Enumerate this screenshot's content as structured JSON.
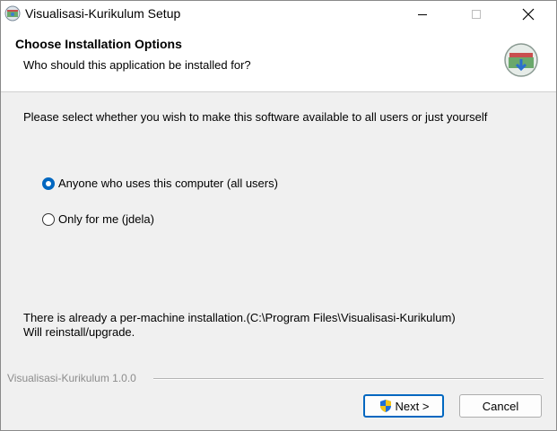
{
  "window": {
    "title": "Visualisasi-Kurikulum Setup"
  },
  "header": {
    "title": "Choose Installation Options",
    "subtitle": "Who should this application be installed for?"
  },
  "main": {
    "intro": "Please select whether you wish to make this software available to all users or just yourself",
    "options": [
      {
        "label": "Anyone who uses this computer (all users)",
        "checked": true
      },
      {
        "label": "Only for me (jdela)",
        "checked": false
      }
    ],
    "note_line1": "There is already a per-machine installation.(C:\\Program Files\\Visualisasi-Kurikulum)",
    "note_line2": "Will reinstall/upgrade."
  },
  "footer": {
    "brand": "Visualisasi-Kurikulum 1.0.0",
    "next_label": "Next >",
    "cancel_label": "Cancel"
  },
  "colors": {
    "accent": "#0067c0",
    "shield_blue": "#1e6fd9",
    "shield_yellow": "#f5c518"
  },
  "icons": [
    "app-icon",
    "minimize-icon",
    "maximize-icon",
    "close-icon",
    "installer-logo-icon",
    "uac-shield-icon"
  ]
}
